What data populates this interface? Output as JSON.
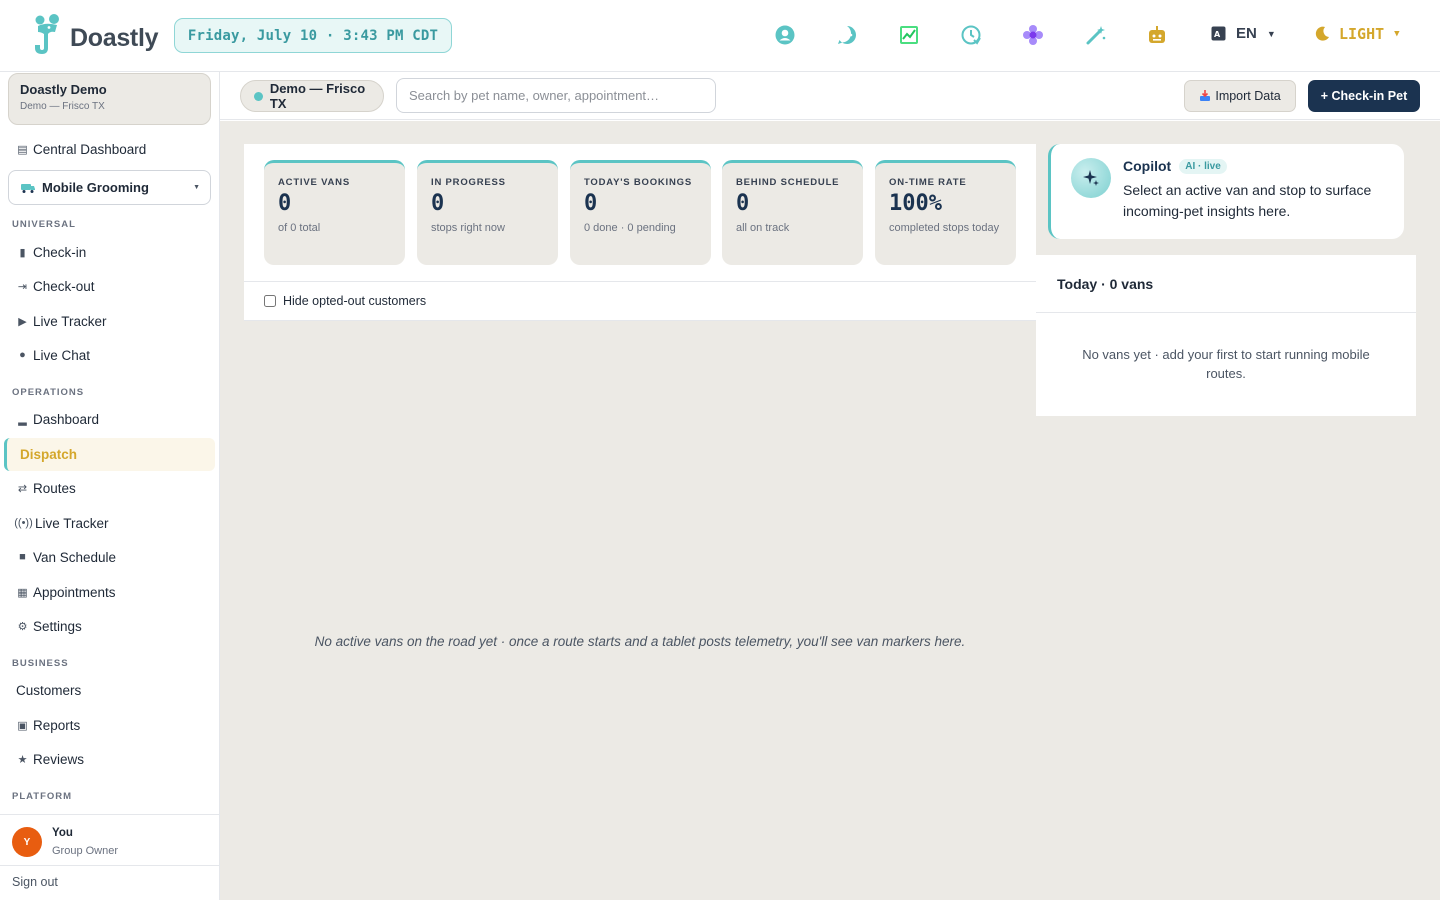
{
  "app": {
    "name": "Doastly",
    "datetime": "Friday, July 10 · 3:43 PM CDT",
    "language": "EN",
    "theme": "LIGHT"
  },
  "top_icons": [
    "support-icon",
    "chat-icon",
    "chart-icon",
    "clock-icon",
    "flower-icon",
    "magic-wand-icon",
    "robot-icon"
  ],
  "tenant": {
    "name": "Doastly Demo",
    "sub": "Demo — Frisco TX"
  },
  "sidebar": {
    "central_dashboard": "Central Dashboard",
    "module": "Mobile Grooming",
    "sections": {
      "universal": "UNIVERSAL",
      "operations": "OPERATIONS",
      "business": "BUSINESS",
      "platform": "PLATFORM"
    },
    "universal_items": [
      "Check-in",
      "Check-out",
      "Live Tracker",
      "Live Chat"
    ],
    "operations_items": [
      "Dashboard",
      "Dispatch",
      "Routes",
      "Live Tracker",
      "Van Schedule",
      "Appointments",
      "Settings"
    ],
    "business_items": [
      "Customers",
      "Reports",
      "Reviews"
    ],
    "active_item": "Dispatch"
  },
  "user": {
    "initial": "Y",
    "name": "You",
    "role": "Group Owner",
    "signout": "Sign out"
  },
  "subheader": {
    "location": "Demo — Frisco TX",
    "search_placeholder": "Search by pet name, owner, appointment…",
    "import_label": "Import Data",
    "checkin_label": "+ Check-in Pet"
  },
  "stats": [
    {
      "label": "ACTIVE VANS",
      "value": "0",
      "sub": "of 0 total"
    },
    {
      "label": "IN PROGRESS",
      "value": "0",
      "sub": "stops right now"
    },
    {
      "label": "TODAY'S BOOKINGS",
      "value": "0",
      "sub": "0 done · 0 pending"
    },
    {
      "label": "BEHIND SCHEDULE",
      "value": "0",
      "sub": "all on track"
    },
    {
      "label": "ON-TIME RATE",
      "value": "100%",
      "sub": "completed stops today"
    }
  ],
  "filter": {
    "hide_opted_out": "Hide opted-out customers"
  },
  "map": {
    "empty": "No active vans on the road yet · once a route starts and a tablet posts telemetry, you'll see van markers here."
  },
  "copilot": {
    "title": "Copilot",
    "badge": "AI · live",
    "text": "Select an active van and stop to surface incoming-pet insights here."
  },
  "vans": {
    "header": "Today · 0 vans",
    "empty": "No vans yet · add your first to start running mobile routes."
  },
  "colors": {
    "accent_teal": "#5bc4c4",
    "navy": "#1b3350",
    "gold": "#d4a72c",
    "avatar_orange": "#e85d10"
  }
}
